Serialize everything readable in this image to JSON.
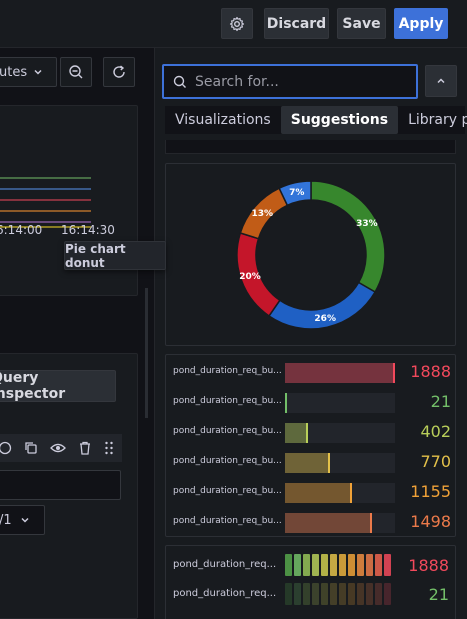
{
  "toolbar": {
    "discard_label": "Discard",
    "save_label": "Save",
    "apply_label": "Apply",
    "gear_icon": "gear-icon",
    "apply_color": "#3d71d9"
  },
  "left": {
    "time_range_fragment": "utes",
    "ticks": [
      "6:14:00",
      "16:14:30"
    ],
    "tooltip": "Pie chart donut",
    "query_inspector_label": "Query inspector",
    "query_select_value": "/1"
  },
  "right": {
    "search_placeholder": "Search for...",
    "tabs": [
      "Visualizations",
      "Suggestions",
      "Library panels"
    ],
    "active_tab": "Suggestions"
  },
  "chart_data": [
    {
      "type": "pie",
      "title": "",
      "labels": [
        "33%",
        "26%",
        "20%",
        "13%",
        "7%"
      ],
      "values": [
        33,
        26,
        20,
        13,
        7
      ],
      "colors": [
        "#37872d",
        "#1f60c4",
        "#c4162a",
        "#c15c17",
        "#3274d9"
      ]
    },
    {
      "type": "bar",
      "categories": [
        "pond_duration_req_bu...",
        "pond_duration_req_bu...",
        "pond_duration_req_bu...",
        "pond_duration_req_bu...",
        "pond_duration_req_bu...",
        "pond_duration_req_bu..."
      ],
      "values": [
        1888,
        21,
        402,
        770,
        1155,
        1498
      ],
      "max": 1888,
      "colors": [
        "#f2495c",
        "#73bf69",
        "#b9cf5a",
        "#e3c14a",
        "#f0a238",
        "#ec7a4a"
      ]
    },
    {
      "type": "bar",
      "categories": [
        "pond_duration_req...",
        "pond_duration_req..."
      ],
      "values": [
        1888,
        21
      ],
      "colors": [
        "#f2495c",
        "#73bf69"
      ]
    }
  ]
}
